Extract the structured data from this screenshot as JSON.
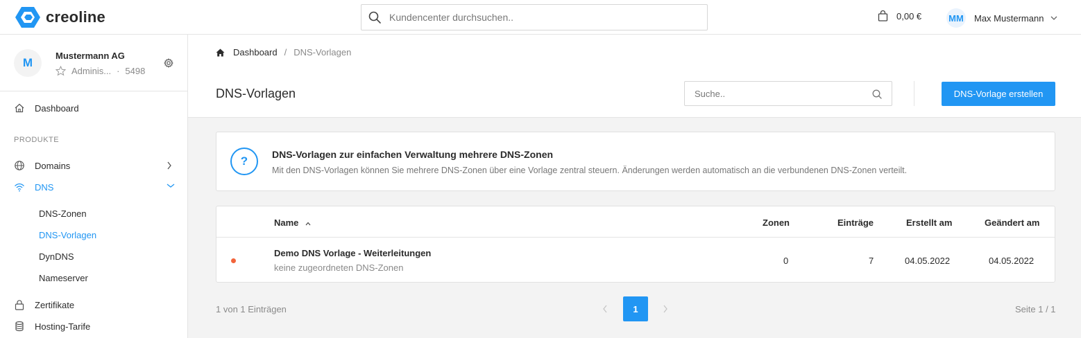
{
  "brand": {
    "name": "creoline",
    "accent": "#2196f3"
  },
  "topbar": {
    "search_placeholder": "Kundencenter durchsuchen..",
    "cart_amount": "0,00 €",
    "user_initials": "MM",
    "user_name": "Max Mustermann"
  },
  "org": {
    "initial": "M",
    "name": "Mustermann AG",
    "role": "Adminis...",
    "separator": "·",
    "id": "5498"
  },
  "sidebar": {
    "dashboard": "Dashboard",
    "section_products": "PRODUKTE",
    "domains": "Domains",
    "dns": "DNS",
    "dns_sub": [
      "DNS-Zonen",
      "DNS-Vorlagen",
      "DynDNS",
      "Nameserver"
    ],
    "certificates": "Zertifikate",
    "hosting": "Hosting-Tarife"
  },
  "breadcrumb": {
    "home": "Dashboard",
    "separator": "/",
    "current": "DNS-Vorlagen"
  },
  "page": {
    "title": "DNS-Vorlagen",
    "search_placeholder": "Suche..",
    "create_button": "DNS-Vorlage erstellen"
  },
  "info": {
    "icon": "?",
    "title": "DNS-Vorlagen zur einfachen Verwaltung mehrere DNS-Zonen",
    "text": "Mit den DNS-Vorlagen können Sie mehrere DNS-Zonen über eine Vorlage zentral steuern. Änderungen werden automatisch an die verbundenen DNS-Zonen verteilt."
  },
  "table": {
    "headers": {
      "name": "Name",
      "zones": "Zonen",
      "entries": "Einträge",
      "created": "Erstellt am",
      "changed": "Geändert am"
    },
    "rows": [
      {
        "status_color": "#f2643b",
        "name": "Demo DNS Vorlage - Weiterleitungen",
        "subtitle": "keine zugeordneten DNS-Zonen",
        "zones": "0",
        "entries": "7",
        "created": "04.05.2022",
        "changed": "04.05.2022"
      }
    ]
  },
  "pagination": {
    "summary": "1 von 1 Einträgen",
    "current_page": "1",
    "page_info": "Seite 1 / 1"
  }
}
